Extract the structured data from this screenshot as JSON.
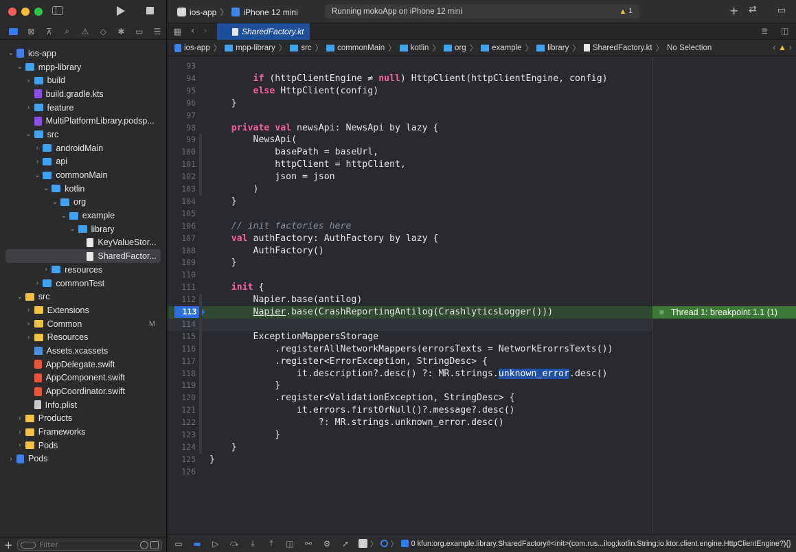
{
  "colors": {
    "accent": "#2f7cf6",
    "keyword": "#fc5fa3",
    "comment": "#7f8c98",
    "breakpoint": "#2b6fe0",
    "thread_badge": "#3b7a35",
    "warning": "#f4c22b"
  },
  "toolbar": {
    "scheme_target": "ios-app",
    "device": "iPhone 12 mini",
    "status": "Running mokoApp on iPhone 12 mini",
    "warning_count": "1"
  },
  "navigator_icons": [
    "folder-icon",
    "source-control-icon",
    "hierarchy-icon",
    "search-icon",
    "warning-icon",
    "test-icon",
    "debug-icon",
    "breakpoint-icon",
    "report-icon"
  ],
  "tree": [
    {
      "label": "ios-app",
      "depth": 0,
      "chev": "⌄",
      "icon": "proj"
    },
    {
      "label": "mpp-library",
      "depth": 1,
      "chev": "⌄",
      "icon": "blue"
    },
    {
      "label": "build",
      "depth": 2,
      "chev": "›",
      "icon": "blue"
    },
    {
      "label": "build.gradle.kts",
      "depth": 2,
      "chev": "",
      "icon": "kt"
    },
    {
      "label": "feature",
      "depth": 2,
      "chev": "›",
      "icon": "blue"
    },
    {
      "label": "MultiPlatformLibrary.podsp...",
      "depth": 2,
      "chev": "",
      "icon": "kt"
    },
    {
      "label": "src",
      "depth": 2,
      "chev": "⌄",
      "icon": "blue"
    },
    {
      "label": "androidMain",
      "depth": 3,
      "chev": "›",
      "icon": "blue"
    },
    {
      "label": "api",
      "depth": 3,
      "chev": "›",
      "icon": "blue"
    },
    {
      "label": "commonMain",
      "depth": 3,
      "chev": "⌄",
      "icon": "blue"
    },
    {
      "label": "kotlin",
      "depth": 4,
      "chev": "⌄",
      "icon": "blue"
    },
    {
      "label": "org",
      "depth": 5,
      "chev": "⌄",
      "icon": "blue"
    },
    {
      "label": "example",
      "depth": 6,
      "chev": "⌄",
      "icon": "blue"
    },
    {
      "label": "library",
      "depth": 7,
      "chev": "⌄",
      "icon": "blue"
    },
    {
      "label": "KeyValueStor...",
      "depth": 8,
      "chev": "",
      "icon": "doc"
    },
    {
      "label": "SharedFactor...",
      "depth": 8,
      "chev": "",
      "icon": "doc",
      "selected": true
    },
    {
      "label": "resources",
      "depth": 4,
      "chev": "›",
      "icon": "blue"
    },
    {
      "label": "commonTest",
      "depth": 3,
      "chev": "›",
      "icon": "blue"
    },
    {
      "label": "src",
      "depth": 1,
      "chev": "⌄",
      "icon": "yellow"
    },
    {
      "label": "Extensions",
      "depth": 2,
      "chev": "›",
      "icon": "yellow"
    },
    {
      "label": "Common",
      "depth": 2,
      "chev": "›",
      "icon": "yellow",
      "badge": "M"
    },
    {
      "label": "Resources",
      "depth": 2,
      "chev": "›",
      "icon": "yellow"
    },
    {
      "label": "Assets.xcassets",
      "depth": 2,
      "chev": "",
      "icon": "assets"
    },
    {
      "label": "AppDelegate.swift",
      "depth": 2,
      "chev": "",
      "icon": "swift"
    },
    {
      "label": "AppComponent.swift",
      "depth": 2,
      "chev": "",
      "icon": "swift"
    },
    {
      "label": "AppCoordinator.swift",
      "depth": 2,
      "chev": "",
      "icon": "swift"
    },
    {
      "label": "Info.plist",
      "depth": 2,
      "chev": "",
      "icon": "plist"
    },
    {
      "label": "Products",
      "depth": 1,
      "chev": "›",
      "icon": "yellow"
    },
    {
      "label": "Frameworks",
      "depth": 1,
      "chev": "›",
      "icon": "yellow"
    },
    {
      "label": "Pods",
      "depth": 1,
      "chev": "›",
      "icon": "yellow"
    },
    {
      "label": "Pods",
      "depth": 0,
      "chev": "›",
      "icon": "proj"
    }
  ],
  "filter": {
    "placeholder": "Filter"
  },
  "editor_tab": {
    "label": "SharedFactory.kt"
  },
  "breadcrumbs": [
    {
      "label": "ios-app",
      "icon": "cp"
    },
    {
      "label": "mpp-library",
      "icon": "cf"
    },
    {
      "label": "src",
      "icon": "cf"
    },
    {
      "label": "commonMain",
      "icon": "cf"
    },
    {
      "label": "kotlin",
      "icon": "cf"
    },
    {
      "label": "org",
      "icon": "cf"
    },
    {
      "label": "example",
      "icon": "cf"
    },
    {
      "label": "library",
      "icon": "cf"
    },
    {
      "label": "SharedFactory.kt",
      "icon": "cd"
    },
    {
      "label": "No Selection",
      "icon": ""
    }
  ],
  "code_lines": [
    {
      "n": "93",
      "parts": []
    },
    {
      "n": "94",
      "parts": [
        [
          "",
          "        "
        ],
        [
          "kw",
          "if"
        ],
        [
          "",
          " (httpClientEngine ≠ "
        ],
        [
          "kw",
          "null"
        ],
        [
          "",
          ") HttpClient(httpClientEngine, config)"
        ]
      ]
    },
    {
      "n": "95",
      "parts": [
        [
          "",
          "        "
        ],
        [
          "kw",
          "else"
        ],
        [
          "",
          " HttpClient(config)"
        ]
      ]
    },
    {
      "n": "96",
      "parts": [
        [
          "",
          "    }"
        ]
      ]
    },
    {
      "n": "97",
      "parts": []
    },
    {
      "n": "98",
      "parts": [
        [
          "",
          "    "
        ],
        [
          "kw",
          "private val"
        ],
        [
          "",
          " newsApi: NewsApi by lazy {"
        ]
      ]
    },
    {
      "n": "99",
      "parts": [
        [
          "",
          "        NewsApi("
        ]
      ]
    },
    {
      "n": "100",
      "parts": [
        [
          "",
          "            basePath = baseUrl,"
        ]
      ]
    },
    {
      "n": "101",
      "parts": [
        [
          "",
          "            httpClient = httpClient,"
        ]
      ]
    },
    {
      "n": "102",
      "parts": [
        [
          "",
          "            json = json"
        ]
      ]
    },
    {
      "n": "103",
      "parts": [
        [
          "",
          "        )"
        ]
      ]
    },
    {
      "n": "104",
      "parts": [
        [
          "",
          "    }"
        ]
      ]
    },
    {
      "n": "105",
      "parts": []
    },
    {
      "n": "106",
      "parts": [
        [
          "",
          "    "
        ],
        [
          "cm",
          "// init factories here"
        ]
      ]
    },
    {
      "n": "107",
      "parts": [
        [
          "",
          "    "
        ],
        [
          "kw",
          "val"
        ],
        [
          "",
          " authFactory: AuthFactory by lazy {"
        ]
      ]
    },
    {
      "n": "108",
      "parts": [
        [
          "",
          "        AuthFactory()"
        ]
      ]
    },
    {
      "n": "109",
      "parts": [
        [
          "",
          "    }"
        ]
      ]
    },
    {
      "n": "110",
      "parts": []
    },
    {
      "n": "111",
      "parts": [
        [
          "",
          "    "
        ],
        [
          "kw",
          "init"
        ],
        [
          "",
          " {"
        ]
      ]
    },
    {
      "n": "112",
      "parts": [
        [
          "",
          "        Napier.base(antilog)"
        ]
      ]
    },
    {
      "n": "113",
      "parts": [
        [
          "",
          "        "
        ],
        [
          "und",
          "Napier"
        ],
        [
          "",
          ".base(CrashReportingAntilog(CrashlyticsLogger()))"
        ]
      ],
      "breakpoint": true
    },
    {
      "n": "114",
      "parts": [],
      "current": true
    },
    {
      "n": "115",
      "parts": [
        [
          "",
          "        ExceptionMappersStorage"
        ]
      ]
    },
    {
      "n": "116",
      "parts": [
        [
          "",
          "            .registerAllNetworkMappers(errorsTexts = NetworkErorrsTexts())"
        ]
      ]
    },
    {
      "n": "117",
      "parts": [
        [
          "",
          "            .register<ErrorException, StringDesc> {"
        ]
      ]
    },
    {
      "n": "118",
      "parts": [
        [
          "",
          "                it.description?.desc() ?: MR.strings."
        ],
        [
          "hl",
          "unknown_error"
        ],
        [
          "",
          ".desc()"
        ]
      ]
    },
    {
      "n": "119",
      "parts": [
        [
          "",
          "            }"
        ]
      ]
    },
    {
      "n": "120",
      "parts": [
        [
          "",
          "            .register<ValidationException, StringDesc> {"
        ]
      ]
    },
    {
      "n": "121",
      "parts": [
        [
          "",
          "                it.errors.firstOrNull()?.message?.desc()"
        ]
      ]
    },
    {
      "n": "122",
      "parts": [
        [
          "",
          "                    ?: MR.strings.unknown_error.desc()"
        ]
      ]
    },
    {
      "n": "123",
      "parts": [
        [
          "",
          "            }"
        ]
      ]
    },
    {
      "n": "124",
      "parts": [
        [
          "",
          "    }"
        ]
      ]
    },
    {
      "n": "125",
      "parts": [
        [
          "",
          "}"
        ]
      ]
    },
    {
      "n": "126",
      "parts": []
    }
  ],
  "thread_badge": {
    "label": "Thread 1: breakpoint 1.1 (1)"
  },
  "debug_bar": {
    "frame": "0 kfun:org.example.library.SharedFactory#<init>(com.rus...ilog;kotlin.String;io.ktor.client.engine.HttpClientEngine?){}"
  }
}
